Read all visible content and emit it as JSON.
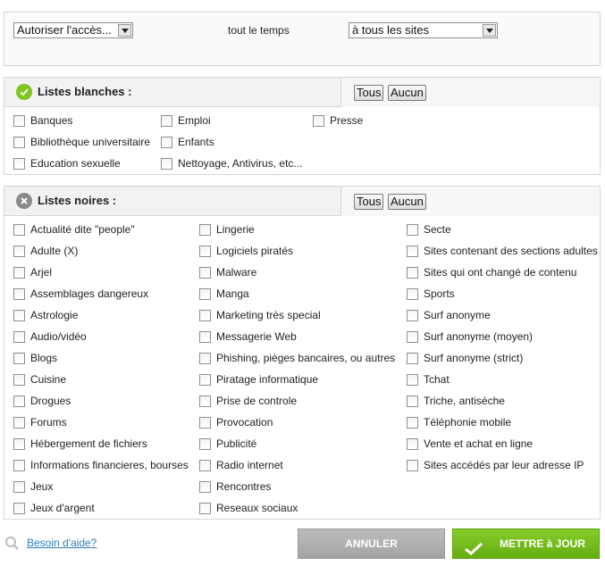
{
  "top": {
    "access_select": "Autoriser l'accès...",
    "time_text": "tout le temps",
    "sites_select": "à tous les sites"
  },
  "whitelists": {
    "title": "Listes blanches :",
    "all_label": "Tous",
    "none_label": "Aucun",
    "items": [
      "Banques",
      "Emploi",
      "Presse",
      "Bibliothèque universitaire",
      "Enfants",
      "Education sexuelle",
      "Nettoyage, Antivirus, etc..."
    ]
  },
  "blacklists": {
    "title": "Listes noires :",
    "all_label": "Tous",
    "none_label": "Aucun",
    "col1": [
      "Actualité dite \"people\"",
      "Adulte (X)",
      "Arjel",
      "Assemblages dangereux",
      "Astrologie",
      "Audio/vidéo",
      "Blogs",
      "Cuisine",
      "Drogues",
      "Forums",
      "Hébergement de fichiers",
      "Informations financieres, bourses",
      "Jeux",
      "Jeux d'argent"
    ],
    "col2": [
      "Lingerie",
      "Logiciels piratés",
      "Malware",
      "Manga",
      "Marketing très special",
      "Messagerie Web",
      "Phishing, pièges bancaires, ou autres",
      "Piratage informatique",
      "Prise de controle",
      "Provocation",
      "Publicité",
      "Radio internet",
      "Rencontres",
      "Reseaux sociaux"
    ],
    "col3": [
      "Secte",
      "Sites contenant des sections adultes",
      "Sites qui ont changé de contenu",
      "Sports",
      "Surf anonyme",
      "Surf anonyme (moyen)",
      "Surf anonyme (strict)",
      "Tchat",
      "Triche, antisèche",
      "Téléphonie mobile",
      "Vente et achat en ligne",
      "Sites accédés par leur adresse IP"
    ]
  },
  "footer": {
    "help_link": "Besoin d'aide?",
    "cancel_label": "ANNULER",
    "update_label": "METTRE à JOUR"
  },
  "colors": {
    "accent_green": "#7cc61d",
    "link_blue": "#2b7ec1",
    "cancel_gray": "#a8a8a8"
  },
  "icons": [
    "checkmark-badge-icon",
    "close-badge-icon",
    "dropdown-arrow-icon",
    "search-icon",
    "check-icon"
  ]
}
